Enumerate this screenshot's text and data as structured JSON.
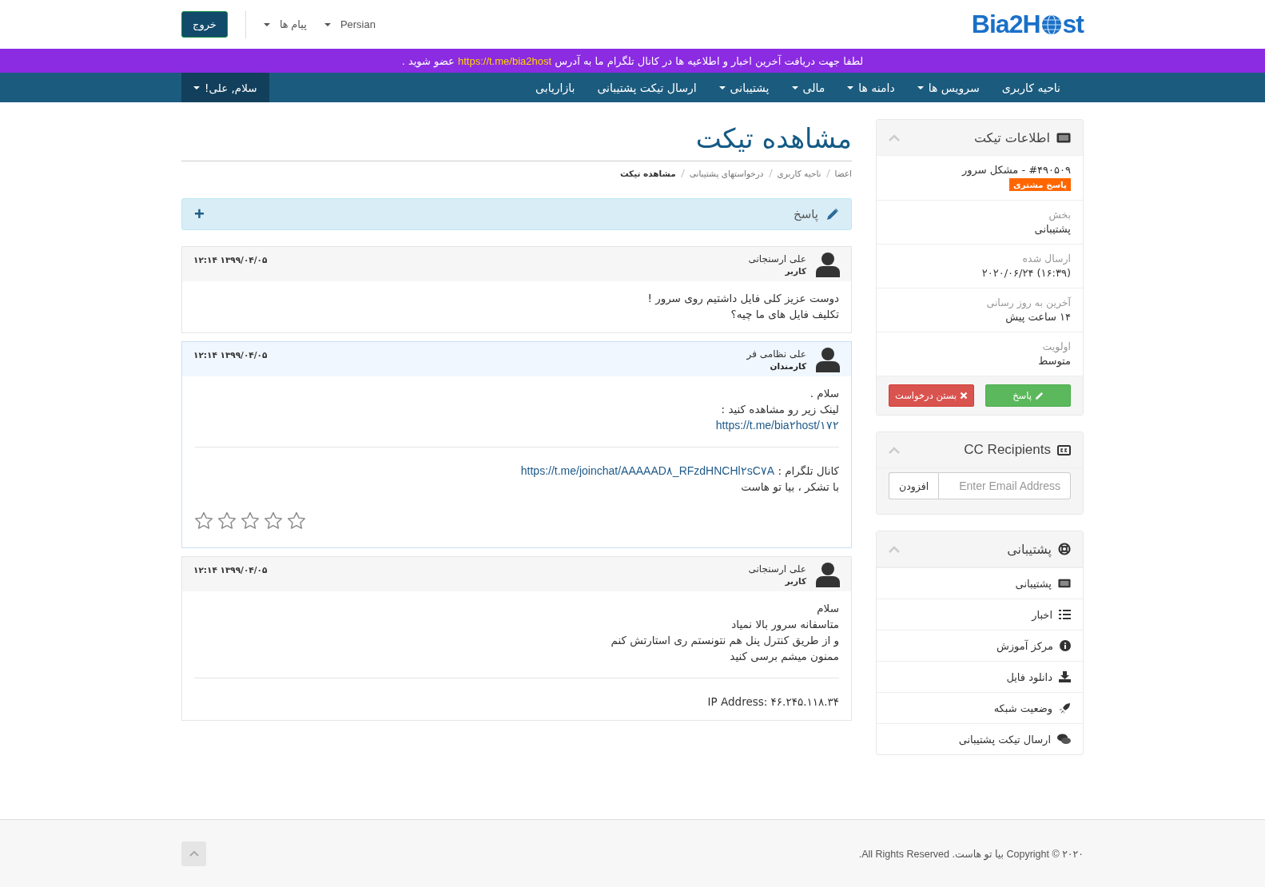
{
  "header": {
    "logo_left": "Bia2H",
    "logo_right": "st",
    "language": "Persian",
    "messages": "پیام ها",
    "logout": "خروج"
  },
  "announcement": {
    "before": "لطفا جهت دریافت آخرین اخبار و اطلاعیه ها در کانال تلگرام ما به آدرس",
    "link": "https://t.me/bia2host",
    "after": "عضو شوید ."
  },
  "nav": {
    "items": [
      {
        "label": "ناحیه کاربری",
        "dropdown": false
      },
      {
        "label": "سرویس ها",
        "dropdown": true
      },
      {
        "label": "دامنه ها",
        "dropdown": true
      },
      {
        "label": "مالی",
        "dropdown": true
      },
      {
        "label": "پشتیبانی",
        "dropdown": true
      },
      {
        "label": "ارسال تیکت پشتیبانی",
        "dropdown": false
      },
      {
        "label": "بازاریابی",
        "dropdown": false
      }
    ],
    "greeting": "سلام, علی!"
  },
  "page_title": "مشاهده تیکت",
  "breadcrumbs": [
    {
      "label": "اعضا",
      "selected": false
    },
    {
      "label": "ناحیه کاربری",
      "selected": false
    },
    {
      "label": "درخواستهای پشتیبانی",
      "selected": false
    },
    {
      "label": "مشاهده تیکت",
      "selected": true
    }
  ],
  "reply_bar": {
    "label": "پاسخ",
    "toggle": "+"
  },
  "messages": [
    {
      "author": "علی ارسنجانی",
      "role": "کاربر",
      "kind": "user",
      "date": "۱۲:۱۴ ۱۳۹۹/۰۴/۰۵",
      "sections": [
        [
          {
            "text": "دوست عزیز کلی فایل داشتیم روی سرور !"
          },
          {
            "text": "تکلیف فایل های ما چیه؟"
          }
        ]
      ]
    },
    {
      "author": "علی نظامی فر",
      "role": "کارمندان",
      "kind": "staff",
      "date": "۱۲:۱۴ ۱۳۹۹/۰۴/۰۵",
      "sections": [
        [
          {
            "text": "سلام ."
          },
          {
            "text": "لینک زیر رو مشاهده کنید :"
          },
          {
            "link": "https://t.me/bia۲host/۱۷۲"
          }
        ],
        [
          {
            "text": "کانال تلگرام :",
            "link": "https://t.me/joinchat/AAAAAD۸_RFzdHNCHl۲sC۷A"
          },
          {
            "text": "با تشکر ، بیا تو هاست"
          }
        ]
      ],
      "stars": 0
    },
    {
      "author": "علی ارسنجانی",
      "role": "کاربر",
      "kind": "user",
      "date": "۱۲:۱۴ ۱۳۹۹/۰۴/۰۵",
      "sections": [
        [
          {
            "text": "سلام"
          },
          {
            "text": "متاسفانه سرور بالا نمیاد"
          },
          {
            "text": "و از طریق کنترل پنل هم نتونستم ری استارتش کنم"
          },
          {
            "text": "ممنون میشم برسی کنید"
          }
        ],
        [
          {
            "text": "IP Address: ۴۶.۲۴۵.۱۱۸.۳۴"
          }
        ]
      ]
    }
  ],
  "ticket_info": {
    "title": "اطلاعات تیکت",
    "subject": "#۴۹۰۵۰۹ - مشکل سرور",
    "status": {
      "label": "پاسخ مشتری",
      "color": "#ff6600"
    },
    "fields": [
      {
        "label": "بخش",
        "value": "پشتیبانی"
      },
      {
        "label": "ارسال شده",
        "value": "(۱۶:۳۹) ۲۰۲۰/۰۶/۲۴"
      },
      {
        "label": "آخرین به روز رسانی",
        "value": "۱۴ ساعت پیش"
      },
      {
        "label": "اولویت",
        "value": "متوسط"
      }
    ],
    "buttons": [
      {
        "label": "پاسخ",
        "kind": "reply"
      },
      {
        "label": "بستن درخواست",
        "kind": "close"
      }
    ]
  },
  "cc_recipients": {
    "title": "CC Recipients",
    "placeholder": "Enter Email Address",
    "button": "افزودن"
  },
  "support_panel": {
    "title": "پشتیبانی",
    "items": [
      {
        "label": "پشتیبانی",
        "kind": "ticket"
      },
      {
        "label": "اخبار",
        "kind": "list"
      },
      {
        "label": "مرکز آموزش",
        "kind": "info"
      },
      {
        "label": "دانلود فایل",
        "kind": "download"
      },
      {
        "label": "وضعیت شبکه",
        "kind": "rocket"
      },
      {
        "label": "ارسال تیکت پشتیبانی",
        "kind": "comments"
      }
    ]
  },
  "footer": {
    "copyright": "۲۰۲۰ © Copyright بیا تو هاست. All Rights Reserved."
  }
}
